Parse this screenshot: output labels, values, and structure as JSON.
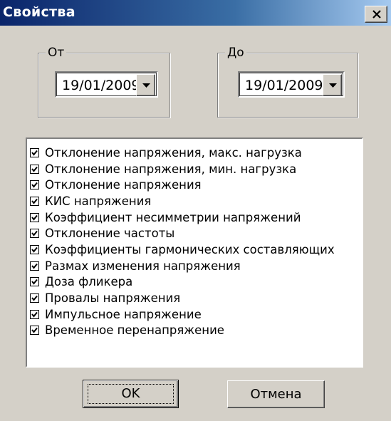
{
  "window": {
    "title": "Свойства"
  },
  "icons": {
    "close": "close-icon",
    "dropdown": "chevron-down-icon",
    "check": "checkmark-icon"
  },
  "from_group": {
    "label": "От",
    "value": "19/01/2009"
  },
  "to_group": {
    "label": "До",
    "value": "19/01/2009"
  },
  "items": [
    {
      "label": "Отклонение напряжения, макс. нагрузка",
      "checked": true
    },
    {
      "label": "Отклонение напряжения, мин. нагрузка",
      "checked": true
    },
    {
      "label": "Отклонение напряжения",
      "checked": true
    },
    {
      "label": "КИС напряжения",
      "checked": true
    },
    {
      "label": "Коэффициент несимметрии напряжений",
      "checked": true
    },
    {
      "label": "Отклонение частоты",
      "checked": true
    },
    {
      "label": "Коэффициенты гармонических составляющих",
      "checked": true
    },
    {
      "label": "Размах изменения напряжения",
      "checked": true
    },
    {
      "label": "Доза фликера",
      "checked": true
    },
    {
      "label": "Провалы напряжения",
      "checked": true
    },
    {
      "label": "Импульсное напряжение",
      "checked": true
    },
    {
      "label": "Временное перенапряжение",
      "checked": true
    }
  ],
  "buttons": {
    "ok": "OK",
    "cancel": "Отмена"
  }
}
